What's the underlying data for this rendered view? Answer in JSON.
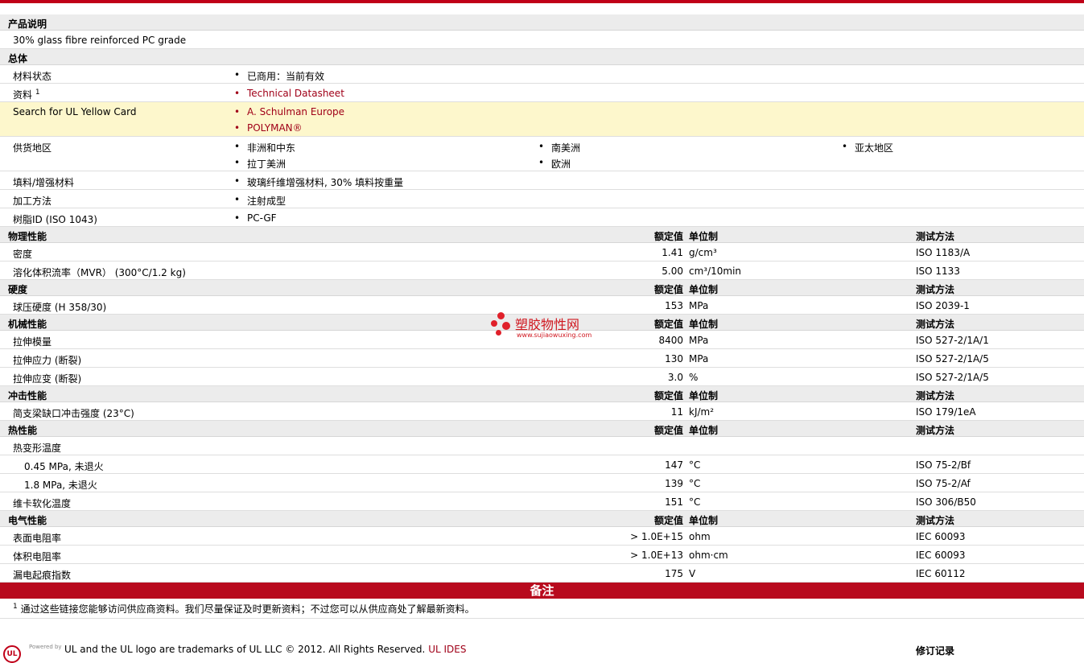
{
  "product": {
    "section": "产品说明",
    "description": "30% glass fibre reinforced PC grade"
  },
  "general": {
    "section": "总体",
    "status_label": "材料状态",
    "status_value": "已商用：当前有效",
    "docs_label": "资料",
    "docs_sup": "1",
    "docs_link": "Technical Datasheet",
    "ul_label": "Search for UL Yellow Card",
    "ul_link1": "A. Schulman Europe",
    "ul_link2": "POLYMAN®",
    "supply_label": "供货地区",
    "supply": [
      "非洲和中东",
      "南美洲",
      "亚太地区",
      "拉丁美洲",
      "欧洲"
    ],
    "filler_label": "填料/增强材料",
    "filler_value": "玻璃纤维增强材料, 30% 填料按重量",
    "process_label": "加工方法",
    "process_value": "注射成型",
    "resin_label": "树脂ID (ISO 1043)",
    "resin_value": "PC-GF"
  },
  "headers": {
    "value": "额定值",
    "unit": "单位制",
    "test": "测试方法"
  },
  "physical": {
    "section": "物理性能",
    "rows": [
      {
        "label": "密度",
        "value": "1.41",
        "unit": "g/cm³",
        "test": "ISO 1183/A"
      },
      {
        "label": "溶化体积流率（MVR） (300°C/1.2 kg)",
        "value": "5.00",
        "unit": "cm³/10min",
        "test": "ISO 1133"
      }
    ]
  },
  "hardness": {
    "section": "硬度",
    "rows": [
      {
        "label": "球压硬度 (H 358/30)",
        "value": "153",
        "unit": "MPa",
        "test": "ISO 2039-1"
      }
    ]
  },
  "mechanical": {
    "section": "机械性能",
    "rows": [
      {
        "label": "拉伸模量",
        "value": "8400",
        "unit": "MPa",
        "test": "ISO 527-2/1A/1"
      },
      {
        "label": "拉伸应力 (断裂)",
        "value": "130",
        "unit": "MPa",
        "test": "ISO 527-2/1A/5"
      },
      {
        "label": "拉伸应变 (断裂)",
        "value": "3.0",
        "unit": "%",
        "test": "ISO 527-2/1A/5"
      }
    ]
  },
  "impact": {
    "section": "冲击性能",
    "rows": [
      {
        "label": "简支梁缺口冲击强度 (23°C)",
        "value": "11",
        "unit": "kJ/m²",
        "test": "ISO 179/1eA"
      }
    ]
  },
  "thermal": {
    "section": "热性能",
    "hdt_label": "热变形温度",
    "rows": [
      {
        "label": "0.45 MPa, 未退火",
        "value": "147",
        "unit": "°C",
        "test": "ISO 75-2/Bf"
      },
      {
        "label": "1.8 MPa, 未退火",
        "value": "139",
        "unit": "°C",
        "test": "ISO 75-2/Af"
      },
      {
        "label": "维卡软化温度",
        "value": "151",
        "unit": "°C",
        "test": "ISO 306/B50"
      }
    ]
  },
  "electrical": {
    "section": "电气性能",
    "rows": [
      {
        "label": "表面电阻率",
        "value": "> 1.0E+15",
        "unit": "ohm",
        "test": "IEC 60093"
      },
      {
        "label": "体积电阻率",
        "value": "> 1.0E+13",
        "unit": "ohm·cm",
        "test": "IEC 60093"
      },
      {
        "label": "漏电起痕指数",
        "value": "175",
        "unit": "V",
        "test": "IEC 60112"
      }
    ]
  },
  "notes": {
    "title": "备注",
    "sup": "1",
    "text": "通过这些链接您能够访问供应商资料。我们尽量保证及时更新资料；不过您可以从供应商处了解最新资料。"
  },
  "footer": {
    "powered": "Powered by",
    "logo": "UL",
    "text": "UL and the UL logo are trademarks of UL LLC © 2012. All Rights Reserved.",
    "link": "UL IDES",
    "revision": "修订记录"
  },
  "watermark": {
    "text": "塑胶物性网",
    "url": "www.sujiaowuxing.com"
  },
  "colors": {
    "accent": "#c00018",
    "section_bg": "#ececec",
    "highlight_bg": "#fdf7cc",
    "link": "#a00018"
  }
}
